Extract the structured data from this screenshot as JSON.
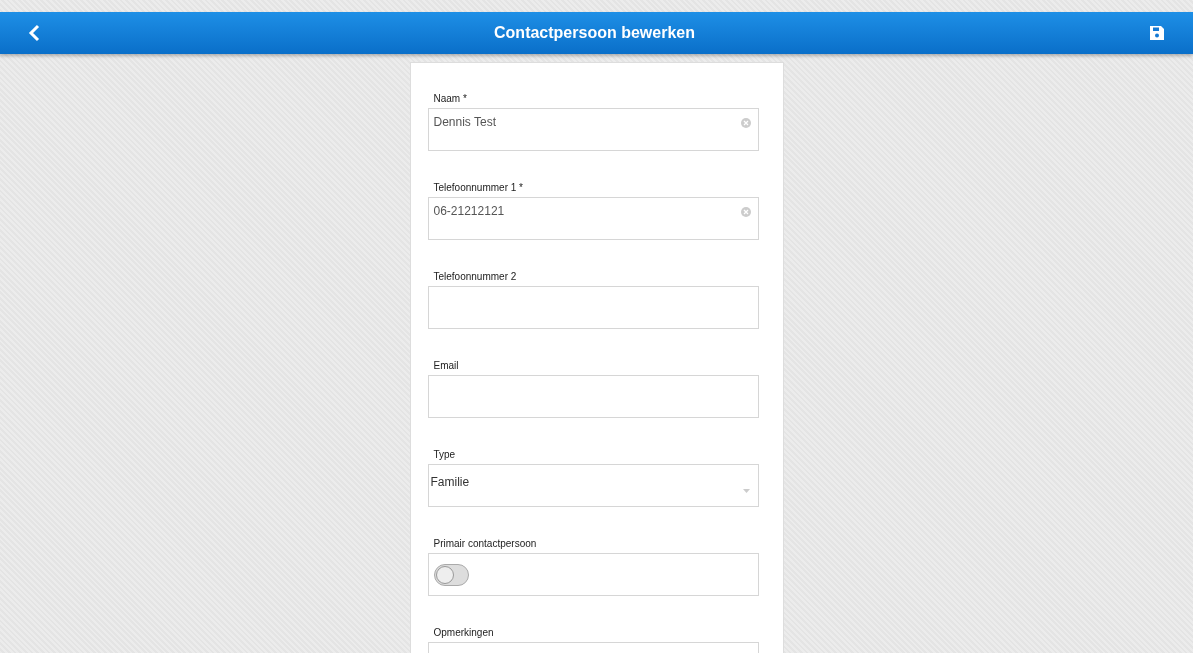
{
  "header": {
    "title": "Contactpersoon bewerken"
  },
  "fields": [
    {
      "kind": "text",
      "label": "Naam *",
      "value": "Dennis Test"
    },
    {
      "kind": "text",
      "label": "Telefoonnummer 1 *",
      "value": "06-21212121"
    },
    {
      "kind": "text",
      "label": "Telefoonnummer 2"
    },
    {
      "kind": "text",
      "label": "Email"
    },
    {
      "kind": "select",
      "label": "Type",
      "value": "Familie"
    },
    {
      "kind": "toggle",
      "label": "Primair contactpersoon",
      "on": false
    },
    {
      "kind": "textarea",
      "label": "Opmerkingen"
    }
  ]
}
